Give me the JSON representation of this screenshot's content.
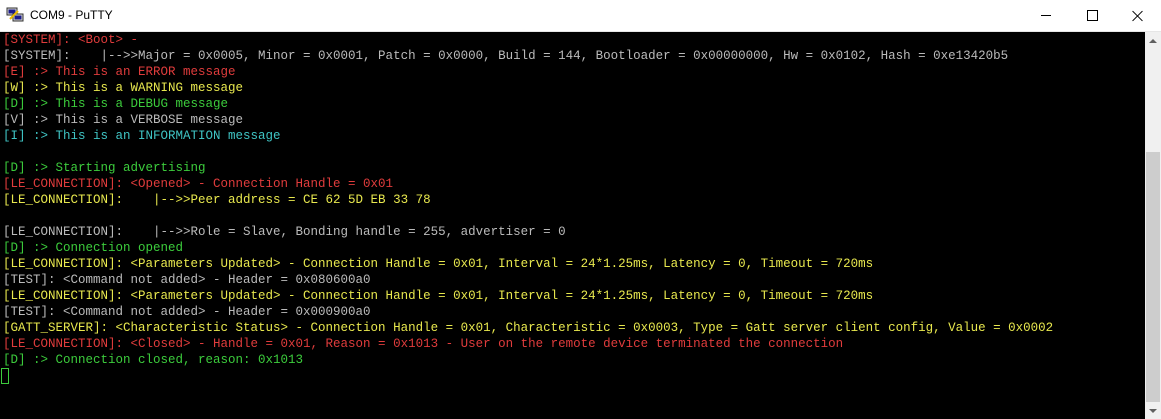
{
  "window": {
    "title": "COM9 - PuTTY",
    "icon": "putty-icon"
  },
  "terminal": {
    "lines": [
      {
        "text": "[SYSTEM]: <Boot> -",
        "color": "#e03c3c"
      },
      {
        "text": "[SYSTEM]:    |-->>Major = 0x0005, Minor = 0x0001, Patch = 0x0000, Build = 144, Bootloader = 0x00000000, Hw = 0x0102, Hash = 0xe13420b5",
        "color": "#bbbbbb"
      },
      {
        "text": "[E] :> This is an ERROR message",
        "color": "#e03c3c"
      },
      {
        "text": "[W] :> This is a WARNING message",
        "color": "#e8e84e"
      },
      {
        "text": "[D] :> This is a DEBUG message",
        "color": "#3ccc3c"
      },
      {
        "text": "[V] :> This is a VERBOSE message",
        "color": "#bbbbbb"
      },
      {
        "text": "[I] :> This is an INFORMATION message",
        "color": "#3fc4c4"
      },
      {
        "text": "",
        "color": "#bbbbbb"
      },
      {
        "text": "[D] :> Starting advertising",
        "color": "#3ccc3c"
      },
      {
        "text": "[LE_CONNECTION]: <Opened> - Connection Handle = 0x01",
        "color": "#e03c3c"
      },
      {
        "text": "[LE_CONNECTION]:    |-->>Peer address = CE 62 5D EB 33 78",
        "color": "#e8e84e"
      },
      {
        "text": "",
        "color": "#bbbbbb"
      },
      {
        "text": "[LE_CONNECTION]:    |-->>Role = Slave, Bonding handle = 255, advertiser = 0",
        "color": "#bbbbbb"
      },
      {
        "text": "[D] :> Connection opened",
        "color": "#3ccc3c"
      },
      {
        "text": "[LE_CONNECTION]: <Parameters Updated> - Connection Handle = 0x01, Interval = 24*1.25ms, Latency = 0, Timeout = 720ms",
        "color": "#e8e84e"
      },
      {
        "text": "[TEST]: <Command not added> - Header = 0x080600a0",
        "color": "#bbbbbb"
      },
      {
        "text": "[LE_CONNECTION]: <Parameters Updated> - Connection Handle = 0x01, Interval = 24*1.25ms, Latency = 0, Timeout = 720ms",
        "color": "#e8e84e"
      },
      {
        "text": "[TEST]: <Command not added> - Header = 0x000900a0",
        "color": "#bbbbbb"
      },
      {
        "text": "[GATT_SERVER]: <Characteristic Status> - Connection Handle = 0x01, Characteristic = 0x0003, Type = Gatt server client config, Value = 0x0002",
        "color": "#e8e84e"
      },
      {
        "text": "[LE_CONNECTION]: <Closed> - Handle = 0x01, Reason = 0x1013 - User on the remote device terminated the connection",
        "color": "#e03c3c"
      },
      {
        "text": "[D] :> Connection closed, reason: 0x1013",
        "color": "#3ccc3c"
      }
    ]
  },
  "colors": {
    "background": "#000000",
    "cursor": "#3ccc3c"
  }
}
